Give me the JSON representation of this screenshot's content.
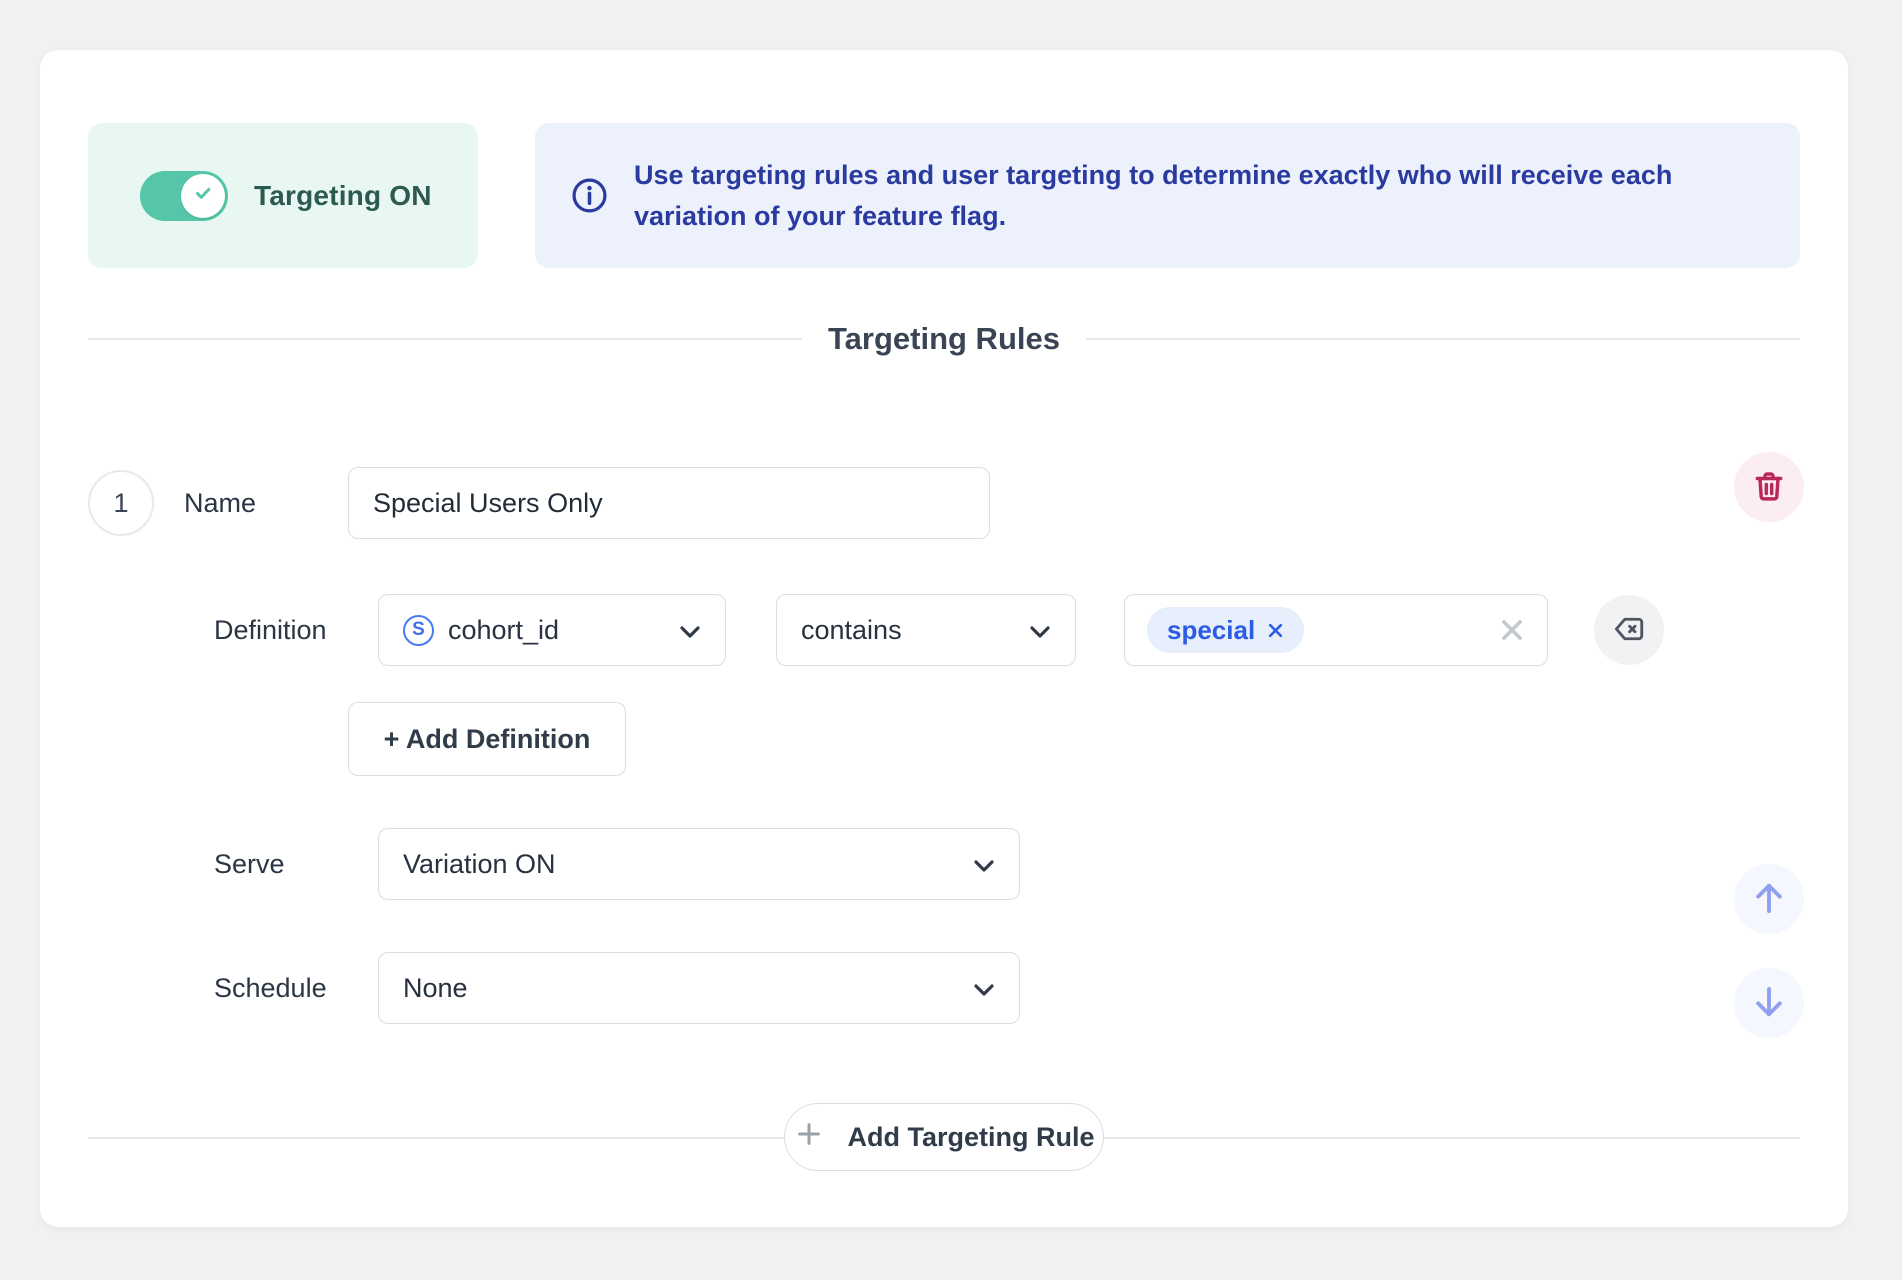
{
  "toggle": {
    "label": "Targeting ON",
    "state": "on",
    "color": "#55c6a9"
  },
  "banner": {
    "icon": "info-icon",
    "text": "Use targeting rules and user targeting to determine exactly who will receive each variation of your feature flag.",
    "line1": "Use targeting rules and user targeting to determine exactly who will receive each",
    "line2": "variation of your feature flag.",
    "bg_color": "#ecf1fc",
    "text_color": "#2a3a9f"
  },
  "section": {
    "title": "Targeting Rules"
  },
  "rule": {
    "index": "1",
    "name": {
      "label": "Name",
      "value": "Special Users Only"
    },
    "definition": {
      "label": "Definition",
      "field": {
        "type_glyph": "S",
        "type_icon": "string-type-icon",
        "value": "cohort_id"
      },
      "operator": {
        "value": "contains"
      },
      "values": {
        "tags": [
          "special"
        ]
      },
      "add_button_label": "+ Add Definition"
    },
    "serve": {
      "label": "Serve",
      "value": "Variation ON"
    },
    "schedule": {
      "label": "Schedule",
      "value": "None"
    }
  },
  "footer": {
    "add_rule_label": "Add Targeting Rule"
  },
  "colors": {
    "page_bg": "#f0f1f3",
    "accent_teal": "#55c6a9",
    "accent_indigo": "#2a3a9f",
    "danger": "#b8295a",
    "move_arrow": "#8fa0ee",
    "tag_blue": "#2b5ce6"
  }
}
